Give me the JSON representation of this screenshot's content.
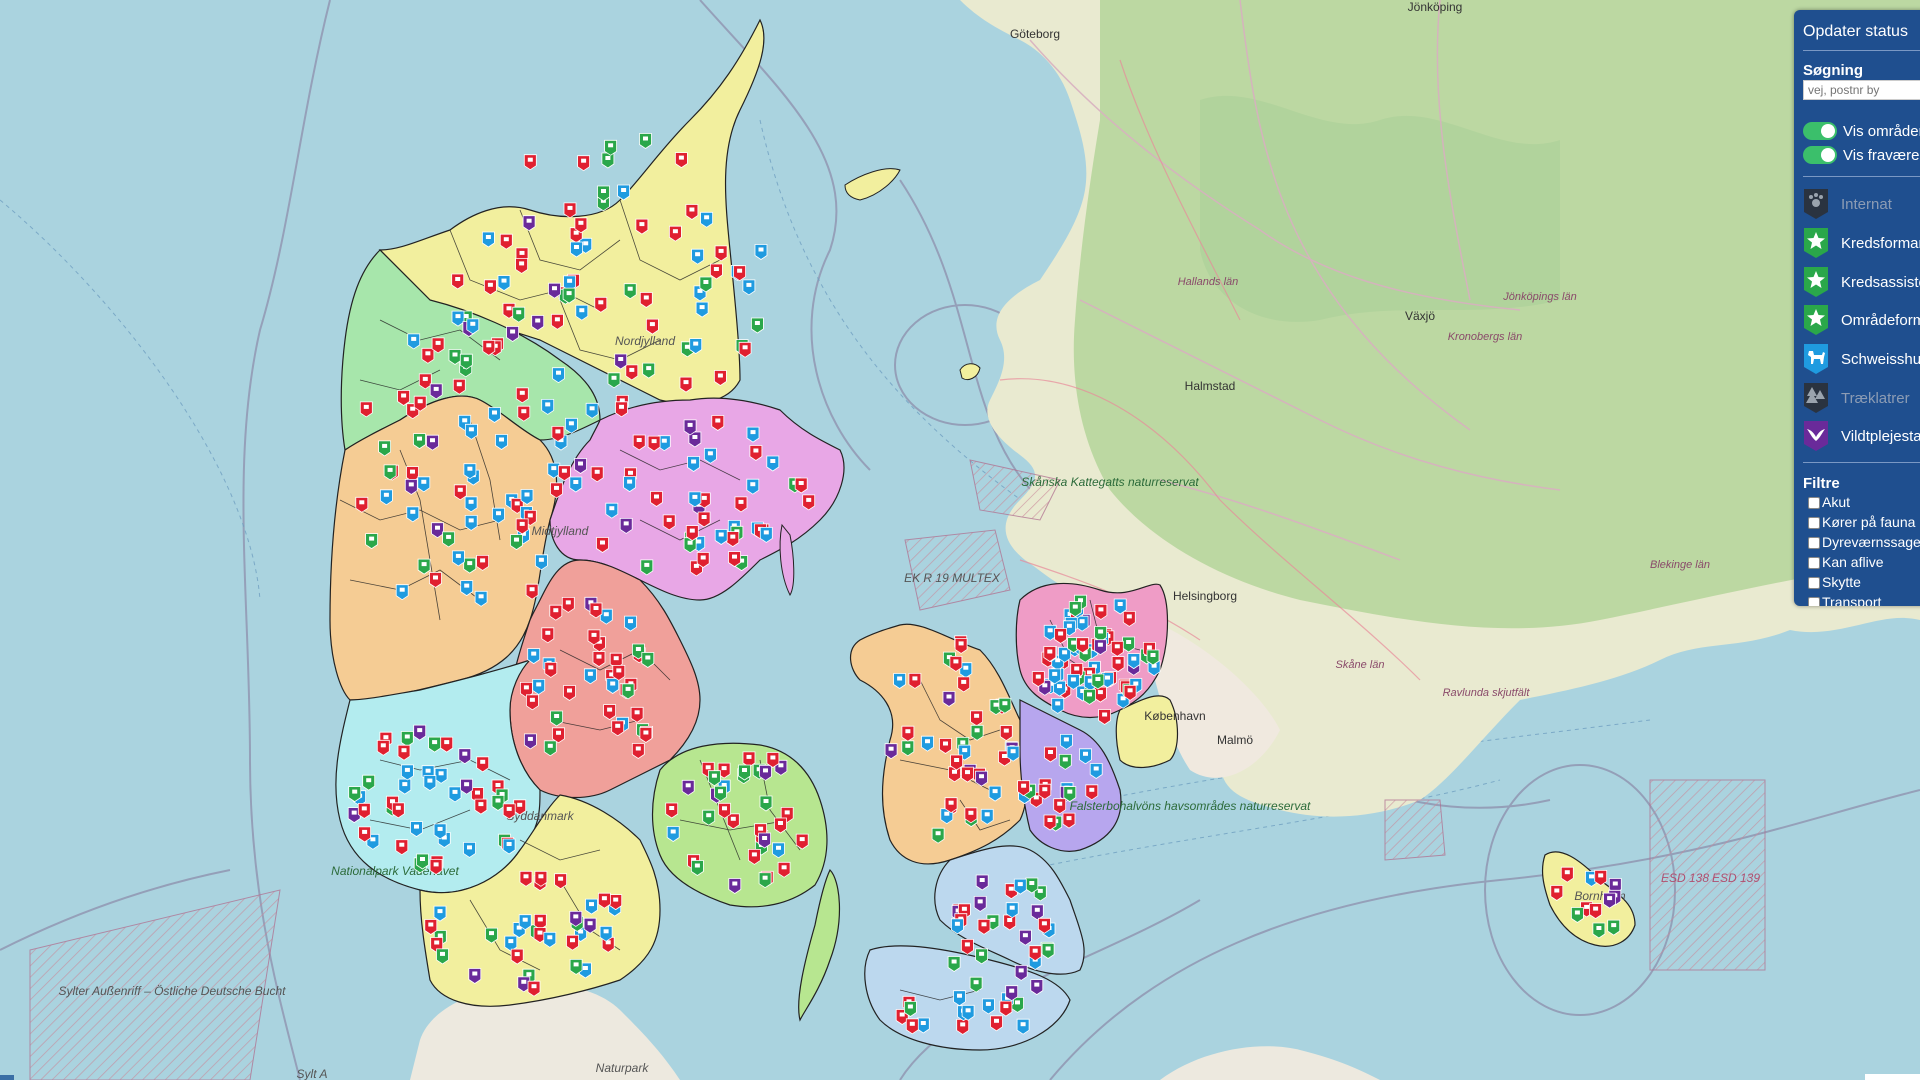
{
  "map": {
    "places": [
      {
        "name": "Göteborg",
        "kind": "city"
      },
      {
        "name": "Jönköping",
        "kind": "city"
      },
      {
        "name": "Jönköpings län",
        "kind": "region"
      },
      {
        "name": "Hallands län",
        "kind": "region"
      },
      {
        "name": "Halmstad",
        "kind": "city"
      },
      {
        "name": "Kronobergs län",
        "kind": "region"
      },
      {
        "name": "Växjö",
        "kind": "city"
      },
      {
        "name": "Blekinge län",
        "kind": "region"
      },
      {
        "name": "Skåne län",
        "kind": "region"
      },
      {
        "name": "Helsingborg",
        "kind": "city"
      },
      {
        "name": "Malmö",
        "kind": "city"
      },
      {
        "name": "Ravlunda skjutfält",
        "kind": "reserve"
      },
      {
        "name": "Skånska Kattegatts naturreservat",
        "kind": "reserve"
      },
      {
        "name": "Falsterbohalvöns havsområdes naturreservat",
        "kind": "reserve"
      },
      {
        "name": "EK R 19 MULTEX",
        "kind": "military"
      },
      {
        "name": "ESD 138",
        "kind": "military"
      },
      {
        "name": "ESD 139",
        "kind": "military"
      },
      {
        "name": "Sylter Außenriff – Östliche Deutsche Bucht",
        "kind": "reserve"
      },
      {
        "name": "Nationalpark Vadehavet",
        "kind": "reserve"
      },
      {
        "name": "Syddanmark",
        "kind": "region"
      },
      {
        "name": "Midtjylland",
        "kind": "region"
      },
      {
        "name": "Nordjylland",
        "kind": "region"
      },
      {
        "name": "Bornholm",
        "kind": "region"
      },
      {
        "name": "København",
        "kind": "city"
      },
      {
        "name": "Naturpark",
        "kind": "reserve"
      },
      {
        "name": "Sylt A",
        "kind": "other"
      }
    ],
    "marker_colors": {
      "red": "#e02030",
      "blue": "#1f9be0",
      "green": "#2aa74a",
      "purple": "#6a2a9a"
    }
  },
  "panel": {
    "update_status": "Opdater status",
    "search_label": "Søgning",
    "search_placeholder": "vej, postnr by",
    "toggles": [
      {
        "label": "Vis områder",
        "on": true
      },
      {
        "label": "Vis fraværende",
        "on": true
      }
    ],
    "legend": [
      {
        "label": "Internat",
        "icon": "paw-icon",
        "color": "#2a3340",
        "dim": true
      },
      {
        "label": "Kredsformand",
        "icon": "star-icon",
        "color": "#2aa74a",
        "dim": false
      },
      {
        "label": "Kredsassistent",
        "icon": "star-icon",
        "color": "#2aa74a",
        "dim": false
      },
      {
        "label": "Områdeformand",
        "icon": "star-icon",
        "color": "#2aa74a",
        "dim": false
      },
      {
        "label": "Schweisshund",
        "icon": "dog-icon",
        "color": "#1f9be0",
        "dim": false
      },
      {
        "label": "Træklatrer",
        "icon": "tree-icon",
        "color": "#2a3340",
        "dim": true
      },
      {
        "label": "Vildtplejestation",
        "icon": "bird-icon",
        "color": "#6a2a9a",
        "dim": false
      }
    ],
    "filters_label": "Filtre",
    "filters": [
      {
        "label": "Akut",
        "checked": false
      },
      {
        "label": "Kører på fauna",
        "checked": false
      },
      {
        "label": "Dyreværnssager",
        "checked": false
      },
      {
        "label": "Kan aflive",
        "checked": false
      },
      {
        "label": "Skytte",
        "checked": false
      },
      {
        "label": "Transport",
        "checked": false
      }
    ]
  }
}
